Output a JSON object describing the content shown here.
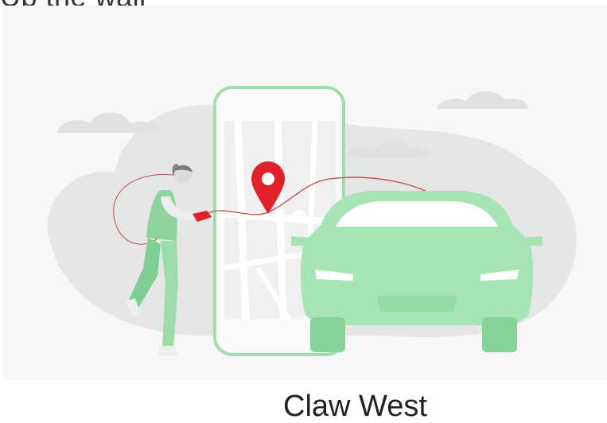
{
  "top_text": "Up the wall",
  "bottom_text": "Claw West",
  "colors": {
    "panel_bg": "#f7f7f7",
    "blob": "#e6e6e6",
    "cloud": "#e1e1e1",
    "phone_frame": "#9fdfae",
    "car_body": "#a6e4b5",
    "car_dark": "#7fcf94",
    "pin": "#e0202a",
    "route": "#c44a4a"
  },
  "icons": [
    "map-pin-icon"
  ]
}
